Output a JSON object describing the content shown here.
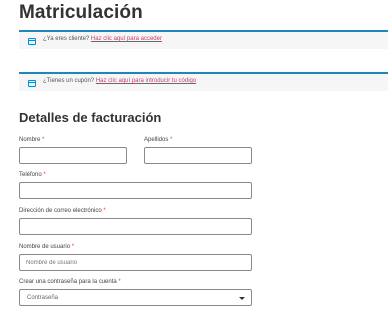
{
  "page": {
    "title": "Matriculación"
  },
  "notices": {
    "login": {
      "text": "¿Ya eres cliente?",
      "link": "Haz clic aquí para acceder"
    },
    "coupon": {
      "text": "¿Tienes un cupón?",
      "link": "Haz clic aquí para introducir tu código"
    }
  },
  "billing": {
    "title": "Detalles de facturación",
    "required_mark": "*",
    "fields": {
      "first_name": {
        "label": "Nombre",
        "value": ""
      },
      "last_name": {
        "label": "Apellidos",
        "value": ""
      },
      "phone": {
        "label": "Teléfono",
        "value": ""
      },
      "email": {
        "label": "Dirección de correo electrónico",
        "value": ""
      },
      "username": {
        "label": "Nombre de usuario",
        "placeholder": "Nombre de usuario"
      },
      "password": {
        "label": "Crear una contraseña para la cuenta",
        "selected": "Contraseña"
      }
    }
  },
  "colors": {
    "accent": "#1e85be",
    "link": "#d6336c",
    "required": "#e2401c"
  }
}
